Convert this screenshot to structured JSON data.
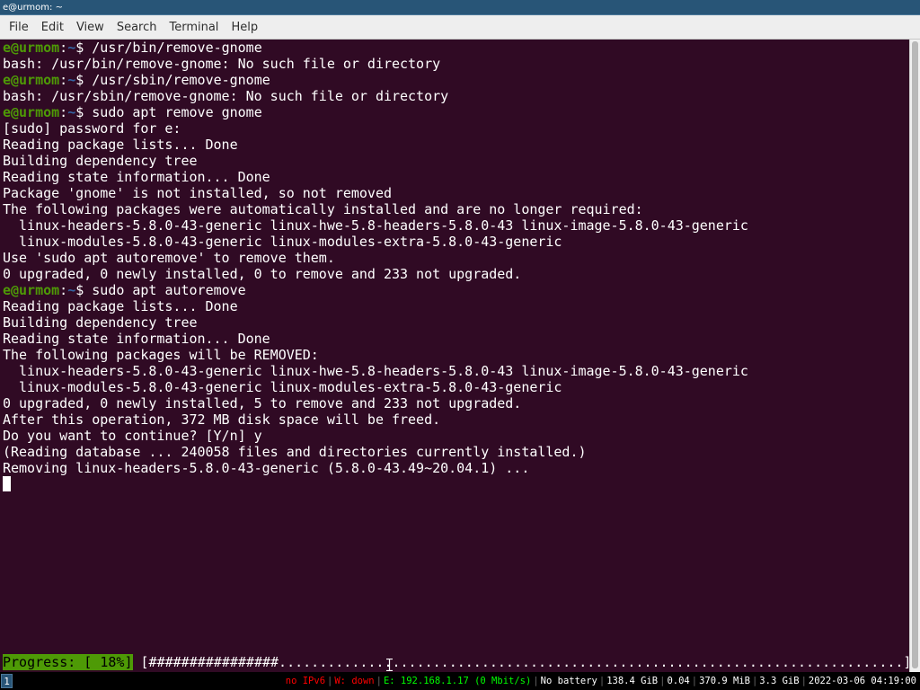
{
  "window": {
    "title": "e@urmom: ~"
  },
  "menu": [
    "File",
    "Edit",
    "View",
    "Search",
    "Terminal",
    "Help"
  ],
  "prompt": {
    "user_host": "e@urmom",
    "path": "~",
    "symbol": "$"
  },
  "terminal_lines": [
    {
      "type": "prompt",
      "command": "/usr/bin/remove-gnome"
    },
    {
      "type": "out",
      "text": "bash: /usr/bin/remove-gnome: No such file or directory"
    },
    {
      "type": "prompt",
      "command": "/usr/sbin/remove-gnome"
    },
    {
      "type": "out",
      "text": "bash: /usr/sbin/remove-gnome: No such file or directory"
    },
    {
      "type": "prompt",
      "command": "sudo apt remove gnome"
    },
    {
      "type": "out",
      "text": "[sudo] password for e:"
    },
    {
      "type": "out",
      "text": "Reading package lists... Done"
    },
    {
      "type": "out",
      "text": "Building dependency tree"
    },
    {
      "type": "out",
      "text": "Reading state information... Done"
    },
    {
      "type": "out",
      "text": "Package 'gnome' is not installed, so not removed"
    },
    {
      "type": "out",
      "text": "The following packages were automatically installed and are no longer required:"
    },
    {
      "type": "out",
      "text": "  linux-headers-5.8.0-43-generic linux-hwe-5.8-headers-5.8.0-43 linux-image-5.8.0-43-generic"
    },
    {
      "type": "out",
      "text": "  linux-modules-5.8.0-43-generic linux-modules-extra-5.8.0-43-generic"
    },
    {
      "type": "out",
      "text": "Use 'sudo apt autoremove' to remove them."
    },
    {
      "type": "out",
      "text": "0 upgraded, 0 newly installed, 0 to remove and 233 not upgraded."
    },
    {
      "type": "prompt",
      "command": "sudo apt autoremove"
    },
    {
      "type": "out",
      "text": "Reading package lists... Done"
    },
    {
      "type": "out",
      "text": "Building dependency tree"
    },
    {
      "type": "out",
      "text": "Reading state information... Done"
    },
    {
      "type": "out",
      "text": "The following packages will be REMOVED:"
    },
    {
      "type": "out",
      "text": "  linux-headers-5.8.0-43-generic linux-hwe-5.8-headers-5.8.0-43 linux-image-5.8.0-43-generic"
    },
    {
      "type": "out",
      "text": "  linux-modules-5.8.0-43-generic linux-modules-extra-5.8.0-43-generic"
    },
    {
      "type": "out",
      "text": "0 upgraded, 0 newly installed, 5 to remove and 233 not upgraded."
    },
    {
      "type": "out",
      "text": "After this operation, 372 MB disk space will be freed."
    },
    {
      "type": "out",
      "text": "Do you want to continue? [Y/n] y"
    },
    {
      "type": "out",
      "text": "(Reading database ... 240058 files and directories currently installed.)"
    },
    {
      "type": "out",
      "text": "Removing linux-headers-5.8.0-43-generic (5.8.0-43.49~20.04.1) ..."
    },
    {
      "type": "cursor"
    }
  ],
  "progress": {
    "label": "Progress: [ 18%]",
    "percent": 18,
    "bar": "[################.............................................................................]"
  },
  "statusbar": {
    "workspace": "1",
    "ipv6": "no IPv6",
    "wireless": "W: down",
    "ethernet": "E: 192.168.1.17 (0 Mbit/s)",
    "battery": "No battery",
    "disk": "138.4 GiB",
    "load": "0.04",
    "memory": "370.9 MiB",
    "swap": "3.3 GiB",
    "datetime": "2022-03-06 04:19:00",
    "colors": {
      "bad": "#ff0000",
      "good": "#00ff00",
      "workspace_bg": "#285577"
    }
  }
}
